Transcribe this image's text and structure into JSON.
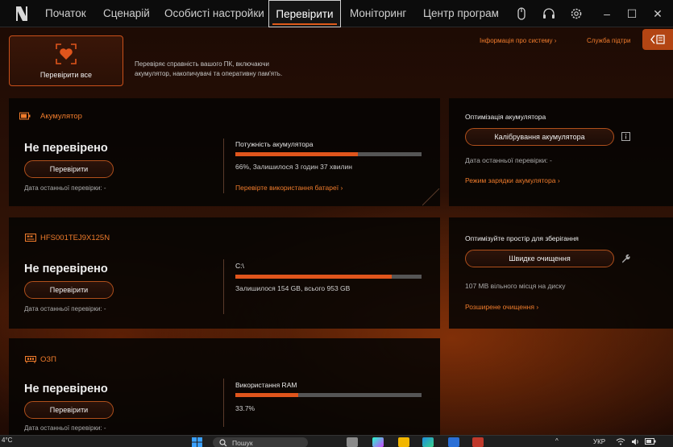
{
  "nav": {
    "tabs": [
      "Початок",
      "Сценарій",
      "Особисті настройки",
      "Перевірити",
      "Моніторинг",
      "Центр програм"
    ],
    "active_tab": "Перевірити"
  },
  "header": {
    "check_all_label": "Перевірити все",
    "description": "Перевіряє справність вашого ПК, включаючи акумулятор, накопичувачі та оперативну пам'ять.",
    "system_info_link": "Інформація про систему ›",
    "support_link": "Служба підтри"
  },
  "battery": {
    "title": "Акумулятор",
    "status": "Не перевірено",
    "check_button": "Перевірити",
    "last_check": "Дата останньої перевірки: -",
    "metric_label": "Потужність акумулятора",
    "percent": 66,
    "metric_text": "66%, Залишилося 3 годин 37 хвилин",
    "link": "Перевірте використання батареї ›"
  },
  "storage": {
    "title": "HFS001TEJ9X125N",
    "status": "Не перевірено",
    "check_button": "Перевірити",
    "last_check": "Дата останньої перевірки: -",
    "drive": "C:\\",
    "used_fraction": 0.84,
    "metric_text": "Залишилося 154 GB, всього 953 GB"
  },
  "ram": {
    "title": "ОЗП",
    "status": "Не перевірено",
    "check_button": "Перевірити",
    "last_check": "Дата останньої перевірки: -",
    "metric_label": "Використання RAM",
    "percent": 33.7,
    "metric_text": "33.7%"
  },
  "battery_opt": {
    "title": "Оптимізація акумулятора",
    "calibrate_button": "Калібрування акумулятора",
    "last_check": "Дата останньої перевірки: -",
    "mode_link": "Режим зарядки акумулятора ›"
  },
  "storage_opt": {
    "title": "Оптимізуйте простір для зберігання",
    "quick_clean_button": "Швидке очищення",
    "free_space": "107 MB вільного місця на диску",
    "advanced_link": "Розширене очищення ›"
  },
  "taskbar": {
    "temperature": "4°C",
    "search_placeholder": "Пошук",
    "language": "УКР"
  },
  "colors": {
    "accent": "#e0551c",
    "link": "#f07c2c",
    "panel": "#060403"
  }
}
